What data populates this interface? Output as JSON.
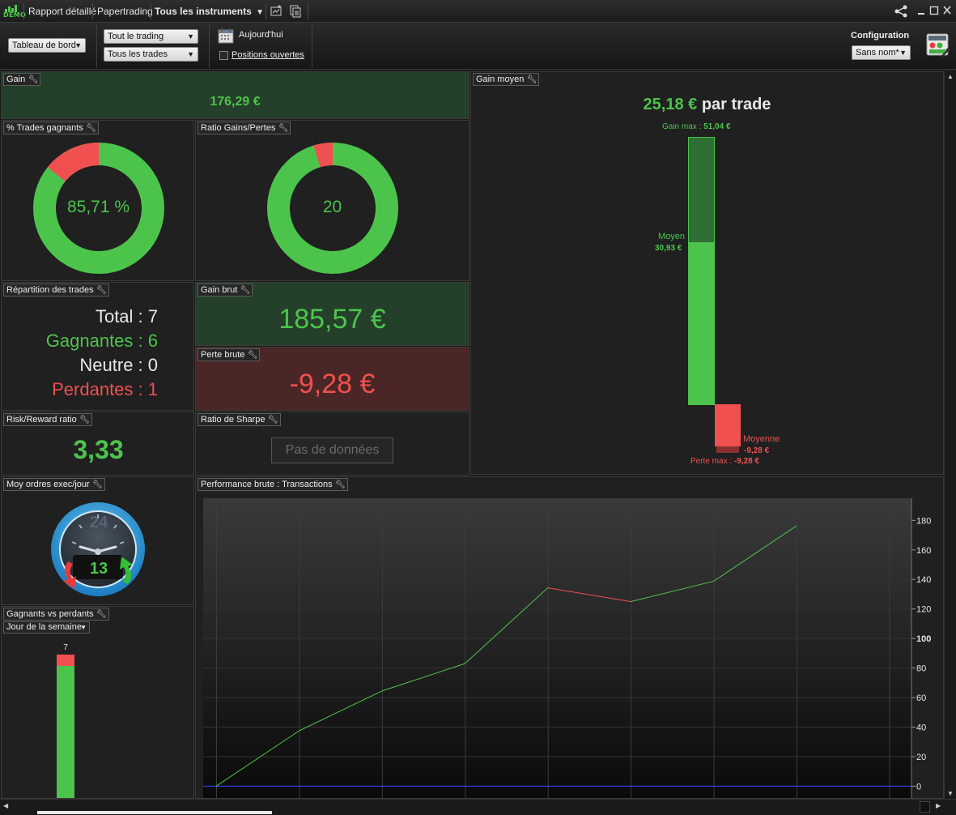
{
  "titlebar": {
    "logo_text": "DEMO",
    "tabs": [
      "Rapport détaillé",
      "Papertrading",
      "Tous les instruments"
    ],
    "instruments_arrow": "⌄"
  },
  "toolbar": {
    "view_select": "Tableau de bord",
    "trading_select": "Tout le trading",
    "trades_select": "Tous les trades",
    "date_label": "Aujourd'hui",
    "positions_label": "Positions ouvertes",
    "positions_checked": false,
    "config_title": "Configuration",
    "config_select": "Sans nom*"
  },
  "panels": {
    "gain": {
      "title": "Gain",
      "value": "176,29 €"
    },
    "gain_moyen": {
      "title": "Gain moyen",
      "headline_value": "25,18 €",
      "headline_suffix": "par trade",
      "gain_max_label": "Gain max :",
      "gain_max_value": "51,04 €",
      "moyen_label": "Moyen",
      "moyen_value": "30,93 €",
      "moyenne_label": "Moyenne",
      "moyenne_value": "-9,28 €",
      "perte_max_label": "Perte max :",
      "perte_max_value": "-9,28 €"
    },
    "pct_gagnants": {
      "title": "% Trades gagnants",
      "value": "85,71 %",
      "win_fraction": 0.8571
    },
    "ratio_gp": {
      "title": "Ratio Gains/Pertes",
      "value": "20",
      "win_fraction": 0.9524
    },
    "repartition": {
      "title": "Répartition des trades",
      "total": "Total : 7",
      "gagnantes": "Gagnantes : 6",
      "neutre": "Neutre : 0",
      "perdantes": "Perdantes : 1"
    },
    "gain_brut": {
      "title": "Gain brut",
      "value": "185,57 €"
    },
    "perte_brute": {
      "title": "Perte brute",
      "value": "-9,28 €"
    },
    "risk_reward": {
      "title": "Risk/Reward ratio",
      "value": "3,33"
    },
    "sharpe": {
      "title": "Ratio de Sharpe",
      "value": "Pas de données"
    },
    "moy_ordres": {
      "title": "Moy ordres exec/jour",
      "clock_label": "24",
      "value": "13"
    },
    "gagnants_vs_perdants": {
      "title": "Gagnants vs perdants",
      "period_select": "Jour de la semaine",
      "bar_label": "7",
      "win_fraction": 0.8571
    },
    "performance": {
      "title": "Performance brute : Transactions"
    }
  },
  "colors": {
    "green": "#4cc44c",
    "red": "#f05050",
    "panel_green": "#25402a",
    "panel_red": "#4a2626"
  },
  "chart_data": {
    "type": "line",
    "title": "Performance brute : Transactions",
    "x": [
      0,
      1,
      2,
      3,
      4,
      5,
      6,
      7
    ],
    "values": [
      0,
      37.47,
      64.47,
      83.0,
      134.3,
      125.0,
      138.8,
      176.29
    ],
    "segment_colors": [
      "green",
      "green",
      "green",
      "green",
      "red",
      "green",
      "green"
    ],
    "y_ticks": [
      0,
      20,
      40,
      60,
      80,
      100,
      120,
      140,
      160,
      180
    ],
    "ylim": [
      -8,
      195
    ],
    "baseline": 0,
    "grid": true
  }
}
